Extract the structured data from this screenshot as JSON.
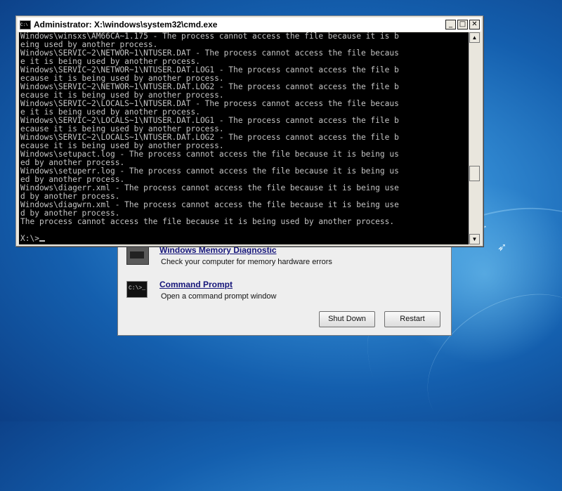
{
  "cmd_window": {
    "icon_text": "C:\\",
    "title": "Administrator: X:\\windows\\system32\\cmd.exe",
    "controls": {
      "minimize": "_",
      "maximize": "□",
      "close": "✕"
    },
    "console_lines": [
      "Windows\\winsxs\\AM66CA~1.175 - The process cannot access the file because it is b",
      "eing used by another process.",
      "Windows\\SERVIC~2\\NETWOR~1\\NTUSER.DAT - The process cannot access the file becaus",
      "e it is being used by another process.",
      "Windows\\SERVIC~2\\NETWOR~1\\NTUSER.DAT.LOG1 - The process cannot access the file b",
      "ecause it is being used by another process.",
      "Windows\\SERVIC~2\\NETWOR~1\\NTUSER.DAT.LOG2 - The process cannot access the file b",
      "ecause it is being used by another process.",
      "Windows\\SERVIC~2\\LOCALS~1\\NTUSER.DAT - The process cannot access the file becaus",
      "e it is being used by another process.",
      "Windows\\SERVIC~2\\LOCALS~1\\NTUSER.DAT.LOG1 - The process cannot access the file b",
      "ecause it is being used by another process.",
      "Windows\\SERVIC~2\\LOCALS~1\\NTUSER.DAT.LOG2 - The process cannot access the file b",
      "ecause it is being used by another process.",
      "Windows\\setupact.log - The process cannot access the file because it is being us",
      "ed by another process.",
      "Windows\\setuperr.log - The process cannot access the file because it is being us",
      "ed by another process.",
      "Windows\\diagerr.xml - The process cannot access the file because it is being use",
      "d by another process.",
      "Windows\\diagwrn.xml - The process cannot access the file because it is being use",
      "d by another process.",
      "The process cannot access the file because it is being used by another process.",
      "",
      "X:\\>"
    ],
    "scroll": {
      "up_arrow": "▲",
      "down_arrow": "▼"
    }
  },
  "recovery_dialog": {
    "items": [
      {
        "link": "Windows Memory Diagnostic",
        "description": "Check your computer for memory hardware errors",
        "icon": "memory-chip-icon"
      },
      {
        "link": "Command Prompt",
        "description": "Open a command prompt window",
        "icon": "command-prompt-icon",
        "icon_text": "C:\\>_"
      }
    ],
    "buttons": {
      "shutdown": "Shut Down",
      "restart": "Restart"
    }
  },
  "colors": {
    "console_bg": "#000000",
    "console_fg": "#c4c4c4",
    "desktop_blue": "#145fae",
    "link": "#15157a"
  }
}
